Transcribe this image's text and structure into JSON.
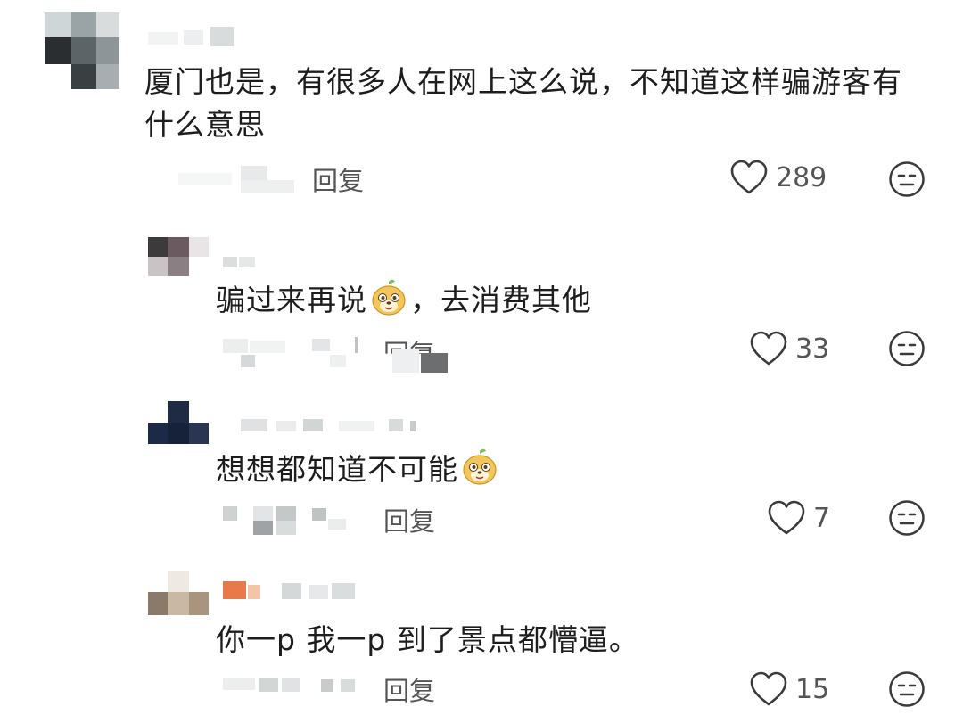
{
  "comments": [
    {
      "text": "厦门也是，有很多人在网上这么说，不知道这样骗游客有什么意思",
      "text_line1": "厦门也是，有很多人在网上这么说，不知道这样骗游客有",
      "text_line2": "什么意思",
      "reply_label": "回复",
      "likes": "289"
    },
    {
      "text_before_emoji": "骗过来再说",
      "emoji": "doge-emoji",
      "text_after_emoji": "，去消费其他",
      "reply_label": "回复",
      "likes": "33"
    },
    {
      "text_before_emoji": "想想都知道不可能",
      "emoji": "doge-emoji",
      "reply_label": "回复",
      "likes": "7"
    },
    {
      "text": "你一p 我一p 到了景点都懵逼。",
      "reply_label": "回复",
      "likes": "15"
    }
  ],
  "colors": {
    "icon_stroke": "#3a3a3a",
    "meta_text": "#555555",
    "body_text": "#1d1d1d"
  },
  "icons": {
    "like": "heart-outline-icon",
    "dislike": "neutral-face-icon"
  }
}
